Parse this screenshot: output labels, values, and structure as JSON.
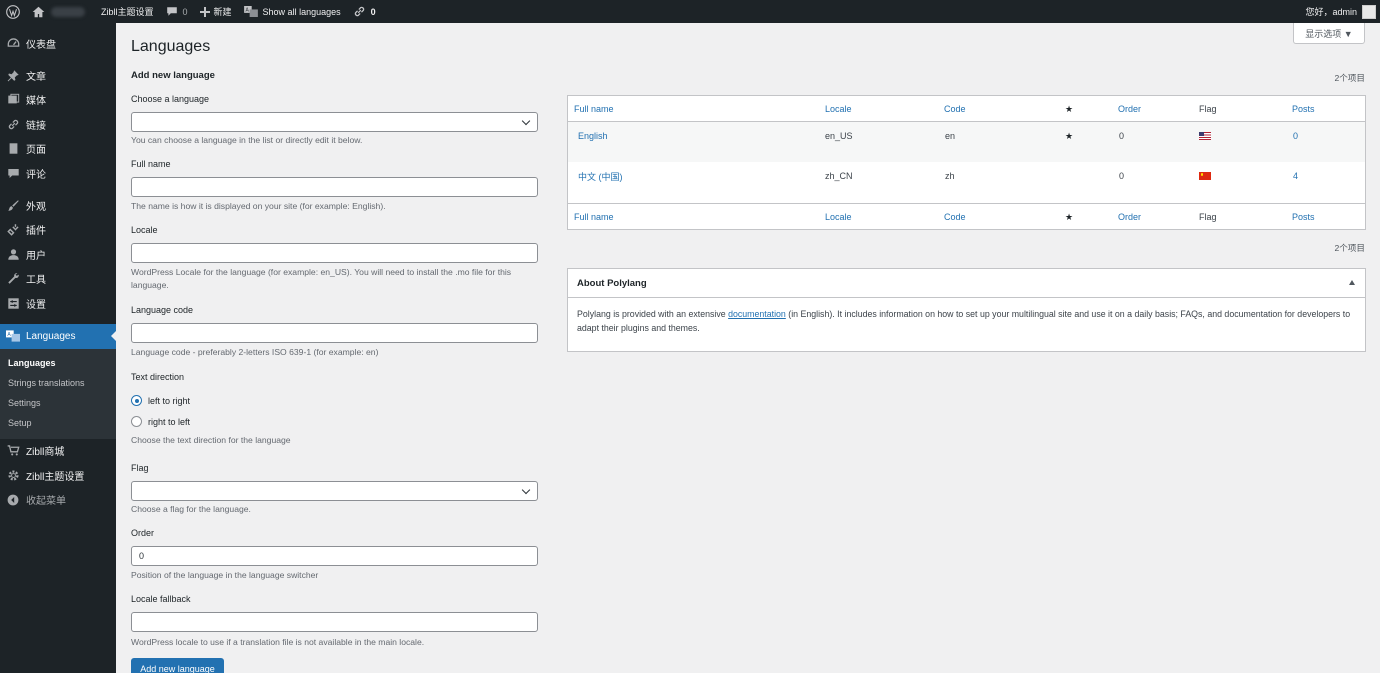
{
  "adminbar": {
    "site_label": "Zibll主题设置",
    "comments_count": "0",
    "new_label": "新建",
    "show_languages_label": "Show all languages",
    "links_count": "0",
    "greeting": "您好，admin"
  },
  "sidebar": {
    "items": [
      {
        "label": "仪表盘",
        "icon": "dashboard-icon"
      },
      {
        "label": "文章",
        "icon": "pin-icon"
      },
      {
        "label": "媒体",
        "icon": "media-icon"
      },
      {
        "label": "链接",
        "icon": "link-icon"
      },
      {
        "label": "页面",
        "icon": "page-icon"
      },
      {
        "label": "评论",
        "icon": "comment-icon"
      },
      {
        "label": "外观",
        "icon": "brush-icon"
      },
      {
        "label": "插件",
        "icon": "plugin-icon"
      },
      {
        "label": "用户",
        "icon": "user-icon"
      },
      {
        "label": "工具",
        "icon": "wrench-icon"
      },
      {
        "label": "设置",
        "icon": "settings-icon"
      },
      {
        "label": "Languages",
        "icon": "translate-icon"
      }
    ],
    "submenu": [
      "Languages",
      "Strings translations",
      "Settings",
      "Setup"
    ],
    "extra": [
      {
        "label": "Zibll商城",
        "icon": "cart-icon"
      },
      {
        "label": "Zibll主题设置",
        "icon": "gear-icon"
      }
    ],
    "collapse_label": "收起菜单"
  },
  "page": {
    "title": "Languages",
    "screen_options": "显示选项 ▼"
  },
  "form": {
    "title": "Add new language",
    "choose_label": "Choose a language",
    "choose_desc": "You can choose a language in the list or directly edit it below.",
    "fullname_label": "Full name",
    "fullname_desc": "The name is how it is displayed on your site (for example: English).",
    "locale_label": "Locale",
    "locale_desc": "WordPress Locale for the language (for example: en_US). You will need to install the .mo file for this language.",
    "code_label": "Language code",
    "code_desc": "Language code - preferably 2-letters ISO 639-1 (for example: en)",
    "direction_label": "Text direction",
    "ltr_label": "left to right",
    "rtl_label": "right to left",
    "direction_desc": "Choose the text direction for the language",
    "flag_label": "Flag",
    "flag_desc": "Choose a flag for the language.",
    "order_label": "Order",
    "order_value": "0",
    "order_desc": "Position of the language in the language switcher",
    "fallback_label": "Locale fallback",
    "fallback_desc": "WordPress locale to use if a translation file is not available in the main locale.",
    "submit_label": "Add new language"
  },
  "table": {
    "count_label": "2个项目",
    "columns": [
      "Full name",
      "Locale",
      "Code",
      "★",
      "Order",
      "Flag",
      "Posts"
    ],
    "rows": [
      {
        "name": "English",
        "locale": "en_US",
        "code": "en",
        "default": "★",
        "order": "0",
        "flag": "us",
        "posts": "0"
      },
      {
        "name": "中文 (中国)",
        "locale": "zh_CN",
        "code": "zh",
        "default": "",
        "order": "0",
        "flag": "cn",
        "posts": "4"
      }
    ]
  },
  "about": {
    "title": "About Polylang",
    "text_before": "Polylang is provided with an extensive ",
    "link_text": "documentation",
    "text_after": " (in English). It includes information on how to set up your multilingual site and use it on a daily basis; FAQs, and documentation for developers to adapt their plugins and themes."
  },
  "colors": {
    "accent": "#2271b1",
    "sidebar_bg": "#1d2327",
    "background": "#f0f0f1"
  }
}
